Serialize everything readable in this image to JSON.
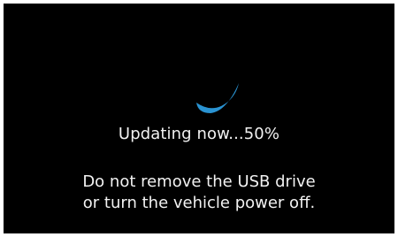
{
  "update_screen": {
    "spinner_icon": "loading-spinner-icon",
    "accent_color": "#2a93d2",
    "status_text": "Updating now...50%",
    "progress_percent": 50,
    "warning_lines": [
      "Do not remove the USB drive",
      "or turn the vehicle power off."
    ]
  }
}
